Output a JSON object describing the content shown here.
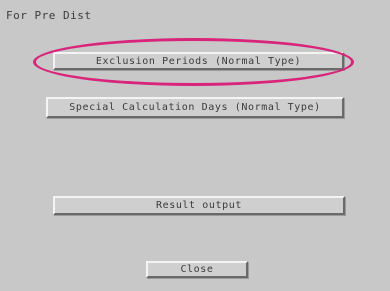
{
  "window": {
    "title": "For Pre Dist"
  },
  "buttons": {
    "exclusion_periods": "Exclusion Periods (Normal Type)",
    "special_calculation": "Special Calculation Days (Normal Type)",
    "result_output": "Result output",
    "close": "Close"
  },
  "annotation": {
    "highlight_color": "#d8247a"
  }
}
